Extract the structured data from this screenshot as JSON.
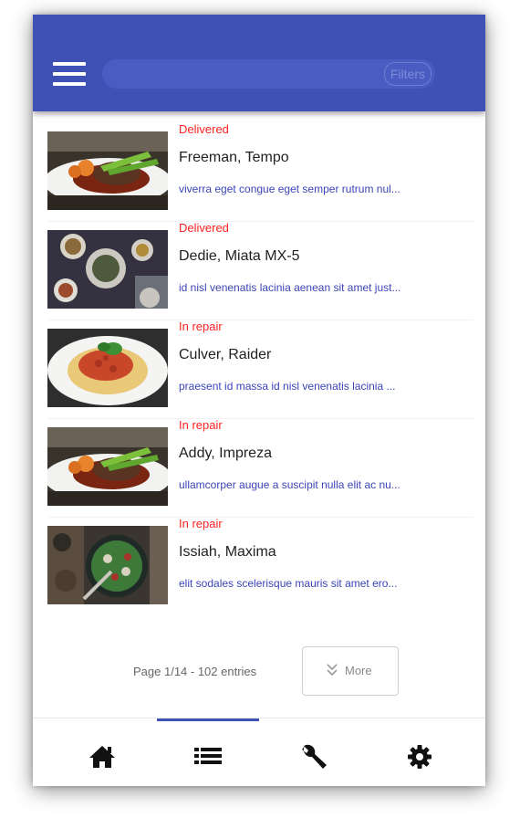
{
  "header": {
    "search_placeholder": "",
    "filters_label": "Filters"
  },
  "items": [
    {
      "status": "Delivered",
      "name": "Freeman, Tempo",
      "description": "viverra eget congue eget semper rutrum nul...",
      "image": "steak-plate-image"
    },
    {
      "status": "Delivered",
      "name": "Dedie, Miata MX-5",
      "description": "id nisl venenatis lacinia aenean sit amet just...",
      "image": "table-dishes-image"
    },
    {
      "status": "In repair",
      "name": "Culver, Raider",
      "description": "praesent id massa id nisl venenatis lacinia ...",
      "image": "spaghetti-plate-image"
    },
    {
      "status": "In repair",
      "name": "Addy, Impreza",
      "description": "ullamcorper augue a suscipit nulla elit ac nu...",
      "image": "steak-plate-image"
    },
    {
      "status": "In repair",
      "name": "Issiah, Maxima",
      "description": "elit sodales scelerisque mauris sit amet ero...",
      "image": "salad-bowl-image"
    }
  ],
  "pager": {
    "text": "Page 1/14 - 102 entries",
    "more_label": "More"
  },
  "bottom_nav": [
    {
      "icon": "home-icon",
      "active": false
    },
    {
      "icon": "list-icon",
      "active": true
    },
    {
      "icon": "wrench-icon",
      "active": false
    },
    {
      "icon": "gear-icon",
      "active": false
    }
  ],
  "colors": {
    "primary": "#3f51b5",
    "status": "#ff2222",
    "description": "#3b45b8"
  }
}
